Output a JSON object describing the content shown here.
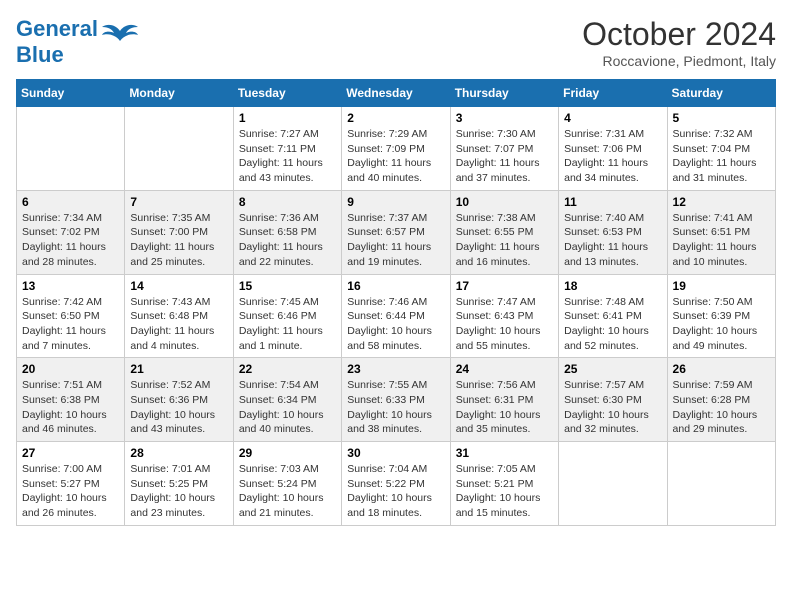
{
  "header": {
    "logo_general": "General",
    "logo_blue": "Blue",
    "month_title": "October 2024",
    "location": "Roccavione, Piedmont, Italy"
  },
  "weekdays": [
    "Sunday",
    "Monday",
    "Tuesday",
    "Wednesday",
    "Thursday",
    "Friday",
    "Saturday"
  ],
  "weeks": [
    [
      null,
      null,
      {
        "day": "1",
        "sunrise": "7:27 AM",
        "sunset": "7:11 PM",
        "daylight": "11 hours and 43 minutes."
      },
      {
        "day": "2",
        "sunrise": "7:29 AM",
        "sunset": "7:09 PM",
        "daylight": "11 hours and 40 minutes."
      },
      {
        "day": "3",
        "sunrise": "7:30 AM",
        "sunset": "7:07 PM",
        "daylight": "11 hours and 37 minutes."
      },
      {
        "day": "4",
        "sunrise": "7:31 AM",
        "sunset": "7:06 PM",
        "daylight": "11 hours and 34 minutes."
      },
      {
        "day": "5",
        "sunrise": "7:32 AM",
        "sunset": "7:04 PM",
        "daylight": "11 hours and 31 minutes."
      }
    ],
    [
      {
        "day": "6",
        "sunrise": "7:34 AM",
        "sunset": "7:02 PM",
        "daylight": "11 hours and 28 minutes."
      },
      {
        "day": "7",
        "sunrise": "7:35 AM",
        "sunset": "7:00 PM",
        "daylight": "11 hours and 25 minutes."
      },
      {
        "day": "8",
        "sunrise": "7:36 AM",
        "sunset": "6:58 PM",
        "daylight": "11 hours and 22 minutes."
      },
      {
        "day": "9",
        "sunrise": "7:37 AM",
        "sunset": "6:57 PM",
        "daylight": "11 hours and 19 minutes."
      },
      {
        "day": "10",
        "sunrise": "7:38 AM",
        "sunset": "6:55 PM",
        "daylight": "11 hours and 16 minutes."
      },
      {
        "day": "11",
        "sunrise": "7:40 AM",
        "sunset": "6:53 PM",
        "daylight": "11 hours and 13 minutes."
      },
      {
        "day": "12",
        "sunrise": "7:41 AM",
        "sunset": "6:51 PM",
        "daylight": "11 hours and 10 minutes."
      }
    ],
    [
      {
        "day": "13",
        "sunrise": "7:42 AM",
        "sunset": "6:50 PM",
        "daylight": "11 hours and 7 minutes."
      },
      {
        "day": "14",
        "sunrise": "7:43 AM",
        "sunset": "6:48 PM",
        "daylight": "11 hours and 4 minutes."
      },
      {
        "day": "15",
        "sunrise": "7:45 AM",
        "sunset": "6:46 PM",
        "daylight": "11 hours and 1 minute."
      },
      {
        "day": "16",
        "sunrise": "7:46 AM",
        "sunset": "6:44 PM",
        "daylight": "10 hours and 58 minutes."
      },
      {
        "day": "17",
        "sunrise": "7:47 AM",
        "sunset": "6:43 PM",
        "daylight": "10 hours and 55 minutes."
      },
      {
        "day": "18",
        "sunrise": "7:48 AM",
        "sunset": "6:41 PM",
        "daylight": "10 hours and 52 minutes."
      },
      {
        "day": "19",
        "sunrise": "7:50 AM",
        "sunset": "6:39 PM",
        "daylight": "10 hours and 49 minutes."
      }
    ],
    [
      {
        "day": "20",
        "sunrise": "7:51 AM",
        "sunset": "6:38 PM",
        "daylight": "10 hours and 46 minutes."
      },
      {
        "day": "21",
        "sunrise": "7:52 AM",
        "sunset": "6:36 PM",
        "daylight": "10 hours and 43 minutes."
      },
      {
        "day": "22",
        "sunrise": "7:54 AM",
        "sunset": "6:34 PM",
        "daylight": "10 hours and 40 minutes."
      },
      {
        "day": "23",
        "sunrise": "7:55 AM",
        "sunset": "6:33 PM",
        "daylight": "10 hours and 38 minutes."
      },
      {
        "day": "24",
        "sunrise": "7:56 AM",
        "sunset": "6:31 PM",
        "daylight": "10 hours and 35 minutes."
      },
      {
        "day": "25",
        "sunrise": "7:57 AM",
        "sunset": "6:30 PM",
        "daylight": "10 hours and 32 minutes."
      },
      {
        "day": "26",
        "sunrise": "7:59 AM",
        "sunset": "6:28 PM",
        "daylight": "10 hours and 29 minutes."
      }
    ],
    [
      {
        "day": "27",
        "sunrise": "7:00 AM",
        "sunset": "5:27 PM",
        "daylight": "10 hours and 26 minutes."
      },
      {
        "day": "28",
        "sunrise": "7:01 AM",
        "sunset": "5:25 PM",
        "daylight": "10 hours and 23 minutes."
      },
      {
        "day": "29",
        "sunrise": "7:03 AM",
        "sunset": "5:24 PM",
        "daylight": "10 hours and 21 minutes."
      },
      {
        "day": "30",
        "sunrise": "7:04 AM",
        "sunset": "5:22 PM",
        "daylight": "10 hours and 18 minutes."
      },
      {
        "day": "31",
        "sunrise": "7:05 AM",
        "sunset": "5:21 PM",
        "daylight": "10 hours and 15 minutes."
      },
      null,
      null
    ]
  ]
}
